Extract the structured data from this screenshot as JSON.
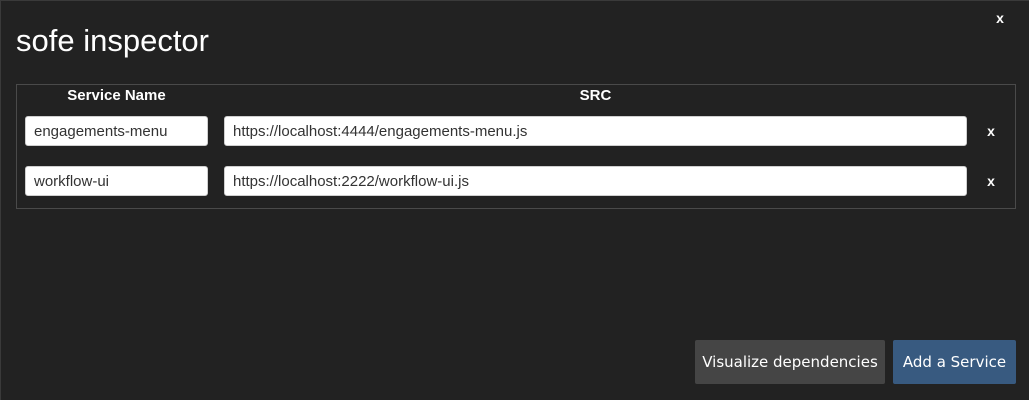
{
  "window": {
    "title": "sofe inspector",
    "close_label": "x"
  },
  "table": {
    "headers": {
      "name": "Service Name",
      "src": "SRC"
    },
    "rows": [
      {
        "name": "engagements-menu",
        "src": "https://localhost:4444/engagements-menu.js",
        "remove_label": "x"
      },
      {
        "name": "workflow-ui",
        "src": "https://localhost:2222/workflow-ui.js",
        "remove_label": "x"
      }
    ]
  },
  "actions": {
    "visualize_label": "Visualize dependencies",
    "add_label": "Add a Service"
  },
  "colors": {
    "background": "#222222",
    "add_button": "#385a80",
    "secondary_button": "#454545"
  }
}
